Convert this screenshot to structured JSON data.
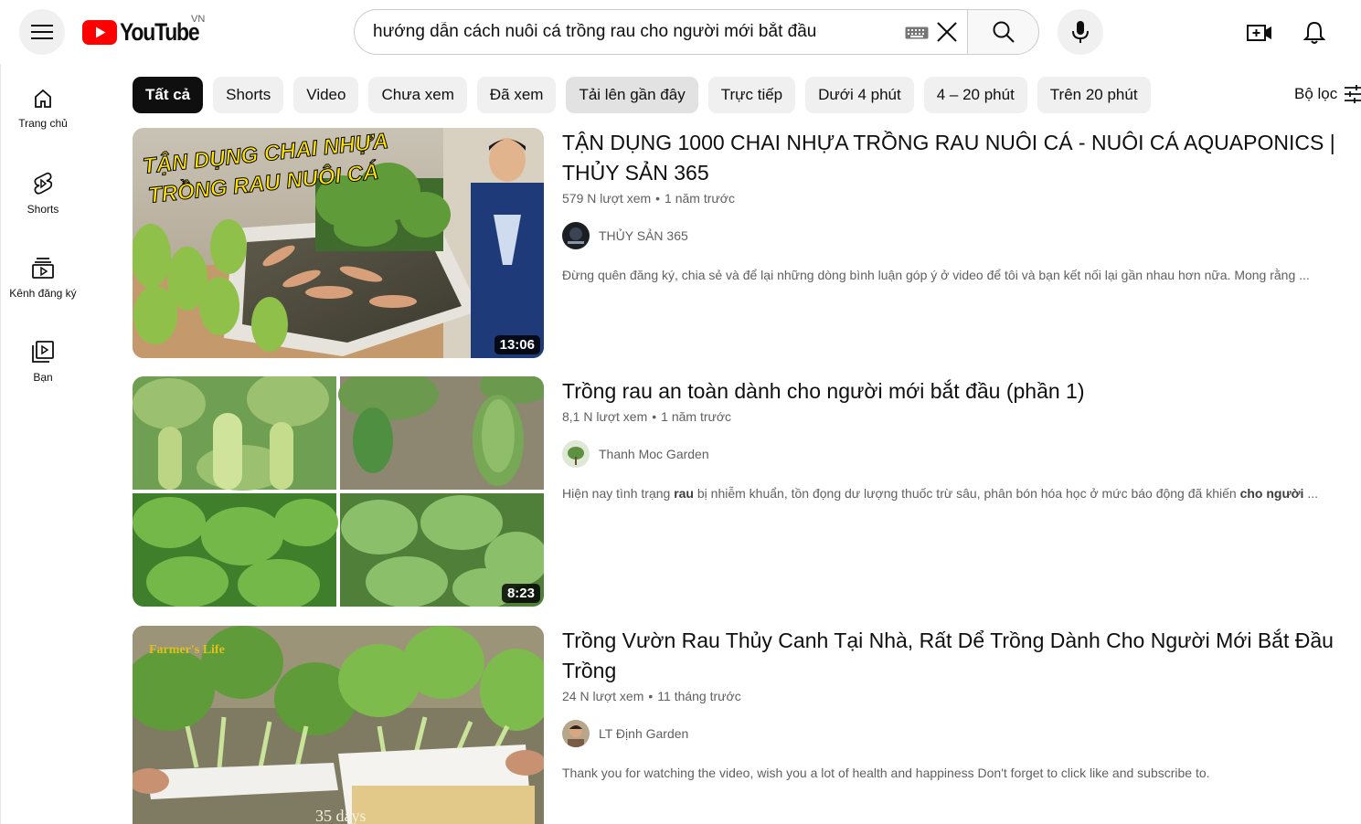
{
  "header": {
    "logo_text": "YouTube",
    "region": "VN",
    "search_value": "hướng dẫn cách nuôi cá trồng rau cho người mới bắt đầu"
  },
  "sidebar": {
    "items": [
      {
        "label": "Trang chủ",
        "icon": "home-icon"
      },
      {
        "label": "Shorts",
        "icon": "shorts-icon"
      },
      {
        "label": "Kênh đăng ký",
        "icon": "subscriptions-icon"
      },
      {
        "label": "Bạn",
        "icon": "you-icon"
      }
    ]
  },
  "chips": [
    "Tất cả",
    "Shorts",
    "Video",
    "Chưa xem",
    "Đã xem",
    "Tải lên gần đây",
    "Trực tiếp",
    "Dưới 4 phút",
    "4 – 20 phút",
    "Trên 20 phút"
  ],
  "filter_label": "Bộ lọc",
  "results": [
    {
      "title": "TẬN DỤNG 1000 CHAI NHỰA TRỒNG RAU NUÔI CÁ - NUÔI CÁ AQUAPONICS | THỦY SẢN 365",
      "views": "579 N lượt xem",
      "age": "1 năm trước",
      "channel": "THỦY SẢN 365",
      "description": "Đừng quên đăng ký, chia sẻ và để lại những dòng bình luận góp ý ở video để tôi và bạn kết nối lại gần nhau hơn nữa. Mong rằng ...",
      "duration": "13:06",
      "thumb_text_1": "TẬN DỤNG CHAI NHỰA",
      "thumb_text_2": "TRỒNG RAU NUÔI CÁ"
    },
    {
      "title": "Trồng rau an toàn dành cho người mới bắt đầu (phần 1)",
      "views": "8,1 N lượt xem",
      "age": "1 năm trước",
      "channel": "Thanh Moc Garden",
      "desc_a": "Hiện nay tình trạng ",
      "desc_b": "rau",
      "desc_c": " bị nhiễm khuẩn, tồn đọng dư lượng thuốc trừ sâu, phân bón hóa học ở mức báo động đã khiến ",
      "desc_d": "cho người",
      "desc_e": " ...",
      "duration": "8:23"
    },
    {
      "title": "Trồng Vườn Rau Thủy Canh Tại Nhà, Rất Dể Trồng Dành Cho Người Mới Bắt Đầu Trồng",
      "views": "24 N lượt xem",
      "age": "11 tháng trước",
      "channel": "LT Định Garden",
      "description": "Thank you for watching the video, wish you a lot of health and happiness Don't forget to click like and subscribe to.",
      "thumb_text_1": "Farmer's Life",
      "thumb_text_2": "35 days"
    }
  ],
  "colors": {
    "brand_red": "#ff0000",
    "chip_bg": "#f0f0f0",
    "chip_active": "#0f0f0f",
    "meta": "#606060"
  }
}
